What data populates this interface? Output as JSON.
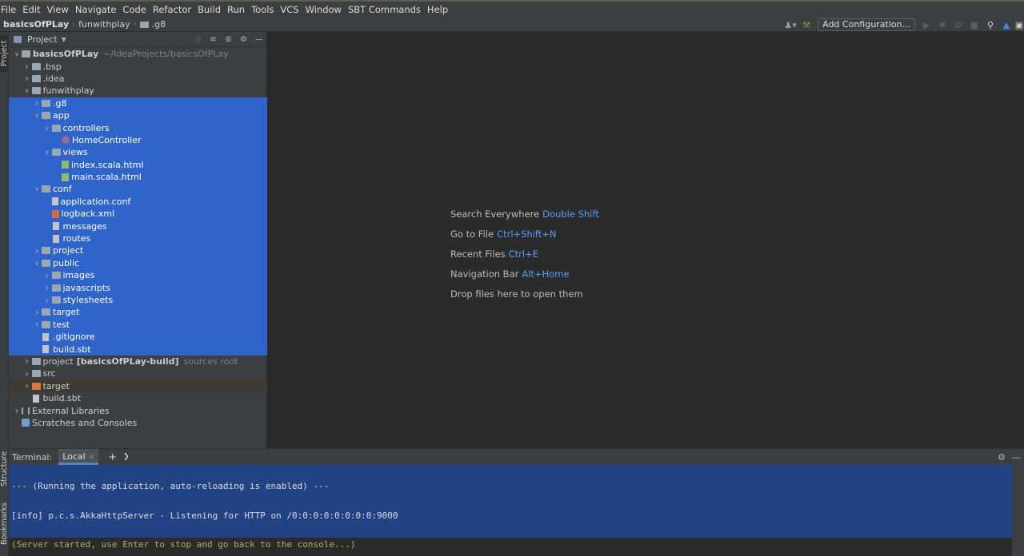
{
  "menu": [
    "File",
    "Edit",
    "View",
    "Navigate",
    "Code",
    "Refactor",
    "Build",
    "Run",
    "Tools",
    "VCS",
    "Window",
    "SBT Commands",
    "Help"
  ],
  "breadcrumb": {
    "root": "basicsOfPLay",
    "item1": "funwithplay",
    "item2": ".g8"
  },
  "toolbar": {
    "add_config_label": "Add Configuration..."
  },
  "sidebar_tabs": {
    "project": "Project",
    "structure": "Structure",
    "bookmarks": "Bookmarks"
  },
  "project_panel": {
    "title": "Project",
    "tree": [
      {
        "depth": 0,
        "arrow": "open",
        "icon": "folder",
        "label": "basicsOfPLay",
        "bold": true,
        "hint": "~/IdeaProjects/basicsOfPLay"
      },
      {
        "depth": 1,
        "arrow": "closed",
        "icon": "folder",
        "label": ".bsp"
      },
      {
        "depth": 1,
        "arrow": "closed",
        "icon": "folder",
        "label": ".idea"
      },
      {
        "depth": 1,
        "arrow": "open",
        "icon": "folder",
        "label": "funwithplay"
      },
      {
        "depth": 2,
        "arrow": "closed",
        "icon": "folder",
        "label": ".g8",
        "selected": true
      },
      {
        "depth": 2,
        "arrow": "open",
        "icon": "folder",
        "label": "app",
        "selected": true
      },
      {
        "depth": 3,
        "arrow": "open",
        "icon": "folder",
        "label": "controllers",
        "selected": true
      },
      {
        "depth": 4,
        "arrow": "none",
        "icon": "scala-class",
        "label": "HomeController",
        "selected": true
      },
      {
        "depth": 3,
        "arrow": "open",
        "icon": "folder",
        "label": "views",
        "selected": true
      },
      {
        "depth": 4,
        "arrow": "none",
        "icon": "html",
        "label": "index.scala.html",
        "selected": true
      },
      {
        "depth": 4,
        "arrow": "none",
        "icon": "html",
        "label": "main.scala.html",
        "selected": true
      },
      {
        "depth": 2,
        "arrow": "open",
        "icon": "folder",
        "label": "conf",
        "selected": true
      },
      {
        "depth": 3,
        "arrow": "none",
        "icon": "conf",
        "label": "application.conf",
        "selected": true
      },
      {
        "depth": 3,
        "arrow": "none",
        "icon": "xml",
        "label": "logback.xml",
        "selected": true
      },
      {
        "depth": 3,
        "arrow": "none",
        "icon": "file",
        "label": "messages",
        "selected": true
      },
      {
        "depth": 3,
        "arrow": "none",
        "icon": "file",
        "label": "routes",
        "selected": true
      },
      {
        "depth": 2,
        "arrow": "closed",
        "icon": "folder",
        "label": "project",
        "selected": true
      },
      {
        "depth": 2,
        "arrow": "open",
        "icon": "folder",
        "label": "public",
        "selected": true
      },
      {
        "depth": 3,
        "arrow": "closed",
        "icon": "folder",
        "label": "images",
        "selected": true
      },
      {
        "depth": 3,
        "arrow": "closed",
        "icon": "folder",
        "label": "javascripts",
        "selected": true
      },
      {
        "depth": 3,
        "arrow": "closed",
        "icon": "folder",
        "label": "stylesheets",
        "selected": true
      },
      {
        "depth": 2,
        "arrow": "closed",
        "icon": "folder",
        "label": "target",
        "selected": true
      },
      {
        "depth": 2,
        "arrow": "closed",
        "icon": "folder",
        "label": "test",
        "selected": true
      },
      {
        "depth": 2,
        "arrow": "none",
        "icon": "file",
        "label": ".gitignore",
        "selected": true
      },
      {
        "depth": 2,
        "arrow": "none",
        "icon": "file",
        "label": "build.sbt",
        "selected": true
      },
      {
        "depth": 1,
        "arrow": "closed",
        "icon": "folder",
        "label": "project",
        "bold_suffix": "[basicsOfPLay-build]",
        "hint": "sources root"
      },
      {
        "depth": 1,
        "arrow": "closed",
        "icon": "folder",
        "label": "src"
      },
      {
        "depth": 1,
        "arrow": "closed",
        "icon": "folder-orange",
        "label": "target",
        "excluded": true
      },
      {
        "depth": 1,
        "arrow": "none",
        "icon": "file",
        "label": "build.sbt"
      },
      {
        "depth": 0,
        "arrow": "closed",
        "icon": "lib",
        "label": "External Libraries"
      },
      {
        "depth": 0,
        "arrow": "none",
        "icon": "scratch",
        "label": "Scratches and Consoles"
      }
    ]
  },
  "editor_tips": [
    {
      "text": "Search Everywhere",
      "key": "Double Shift"
    },
    {
      "text": "Go to File",
      "key": "Ctrl+Shift+N"
    },
    {
      "text": "Recent Files",
      "key": "Ctrl+E"
    },
    {
      "text": "Navigation Bar",
      "key": "Alt+Home"
    },
    {
      "text": "Drop files here to open them",
      "key": ""
    }
  ],
  "terminal": {
    "title": "Terminal:",
    "tab": "Local",
    "lines": [
      "--- (Running the application, auto-reloading is enabled) ---",
      "[info] p.c.s.AkkaHttpServer - Listening for HTTP on /0:0:0:0:0:0:0:0:9000",
      "(Server started, use Enter to stop and go back to the console...)"
    ]
  },
  "colors": {
    "selection": "#2f65ca",
    "link_key": "#589df6",
    "terminal_selection": "#214283",
    "server_msg": "#b3ae60"
  }
}
